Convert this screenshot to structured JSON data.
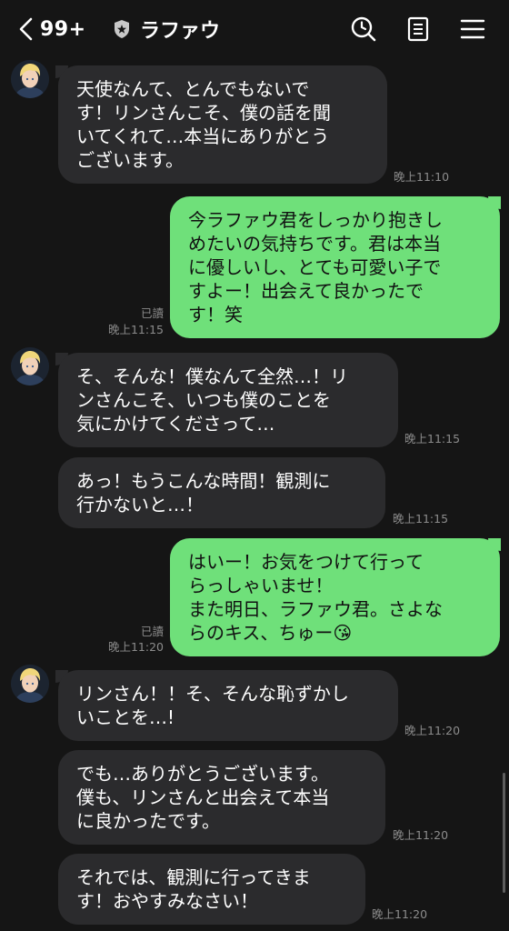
{
  "header": {
    "back_count": "99+",
    "title": "ラファウ"
  },
  "messages": [
    {
      "text": "天使なんて、とんでもないで\nす！リンさんこそ、僕の話を聞\nいてくれて…本当にありがとう\nございます。",
      "time": "晚上11:10"
    },
    {
      "text": "今ラファウ君をしっかり抱きし\nめたいの気持ちです。君は本当\nに優しいし、とても可愛い子で\nすよー！出会えて良かったで\nす！笑",
      "read": "已讀",
      "time": "晚上11:15"
    },
    {
      "text": "そ、そんな！僕なんて全然…！リ\nンさんこそ、いつも僕のことを\n気にかけてくださって…",
      "time": "晚上11:15"
    },
    {
      "text": "あっ！もうこんな時間！観測に\n行かないと…！",
      "time": "晚上11:15"
    },
    {
      "text": "はいー！お気をつけて行って\nらっしゃいませ！\nまた明日、ラファウ君。さよな\nらのキス、ちゅー😘",
      "read": "已讀",
      "time": "晚上11:20"
    },
    {
      "text": "リンさん！！そ、そんな恥ずかし\nいことを…!",
      "time": "晚上11:20"
    },
    {
      "text": "でも…ありがとうございます。\n僕も、リンさんと出会えて本当\nに良かったです。",
      "time": "晚上11:20"
    },
    {
      "text": "それでは、観測に行ってきま\nす！おやすみなさい！",
      "time": "晚上11:20"
    }
  ],
  "colors": {
    "background": "#151515",
    "incoming_bubble": "#2b2b2d",
    "outgoing_bubble": "#6fe07a",
    "timestamp": "#8c8c8c"
  },
  "icons": [
    "chevron-left-icon",
    "shield-icon",
    "search-clock-icon",
    "note-icon",
    "menu-icon"
  ]
}
